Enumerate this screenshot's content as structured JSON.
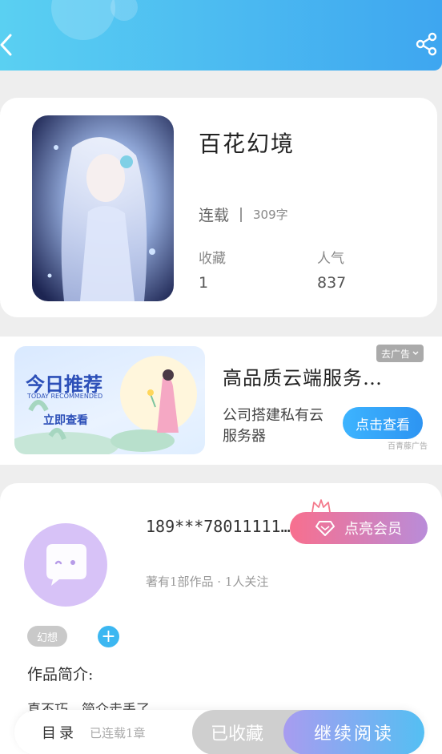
{
  "header": {
    "back_icon": "chevron-left-icon",
    "share_icon": "share-icon"
  },
  "book": {
    "title": "百花幻境",
    "status": "连载",
    "word_count": "309字",
    "favorites_label": "收藏",
    "favorites_value": "1",
    "popularity_label": "人气",
    "popularity_value": "837"
  },
  "ad": {
    "banner_title": "今日推荐",
    "banner_subtitle": "TODAY RECOMMENDED",
    "banner_button": "立即查看",
    "title": "高品质云端服务…",
    "description": "公司搭建私有云服务器",
    "cta": "点击查看",
    "close_tag": "去广告",
    "source": "百青藤广告"
  },
  "author": {
    "name": "189***78011111…",
    "vip_button": "点亮会员",
    "meta": "著有1部作品 · 1人关注",
    "genre_tag": "幻想",
    "add_tag": "+",
    "intro_label": "作品简介:",
    "intro_text": "真不巧，简介走丢了"
  },
  "bottom_bar": {
    "toc_label": "目录",
    "toc_count": "已连载1章",
    "favorited_label": "已收藏",
    "continue_label": "继续阅读"
  },
  "colors": {
    "header_start": "#5ad0f2",
    "header_end": "#3ea6f0",
    "accent_blue": "#3cb7f1",
    "vip_start": "#f86f8e",
    "vip_end": "#b98cd9"
  }
}
